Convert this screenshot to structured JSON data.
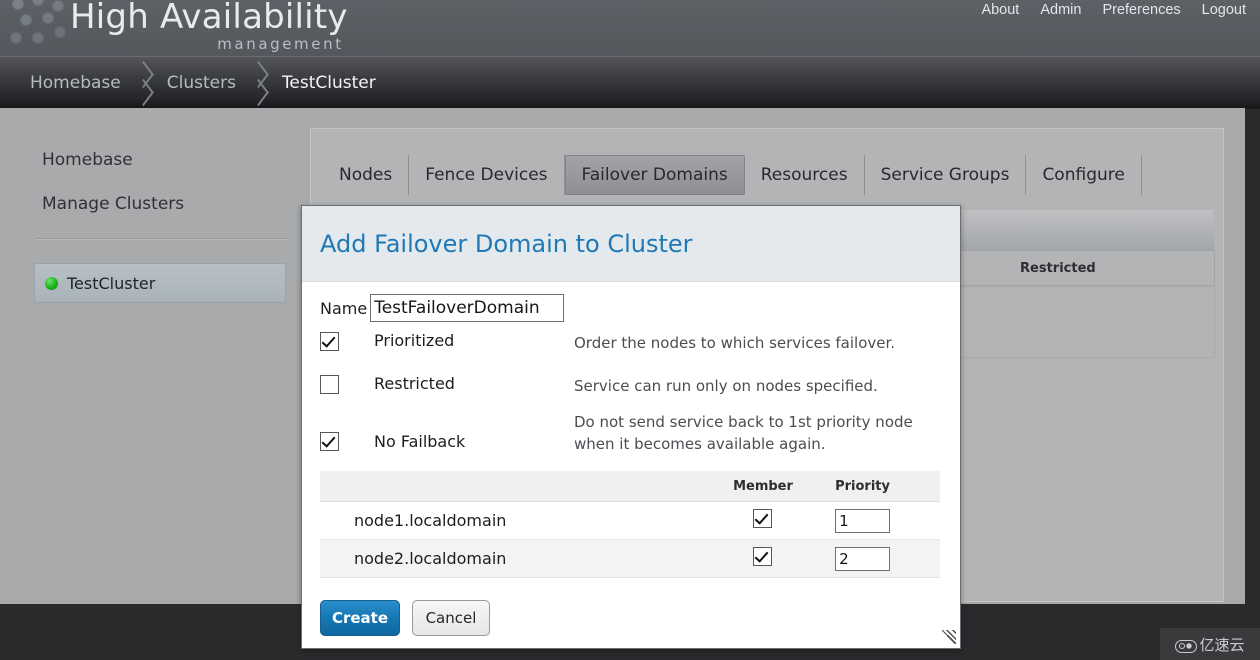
{
  "brand": {
    "title": "High Availability",
    "subtitle": "management",
    "logo_icon": "hex-dots-logo-icon"
  },
  "topnav": {
    "items": [
      {
        "label": "About"
      },
      {
        "label": "Admin"
      },
      {
        "label": "Preferences"
      },
      {
        "label": "Logout"
      }
    ]
  },
  "breadcrumb": {
    "items": [
      {
        "label": "Homebase",
        "active": false
      },
      {
        "label": "Clusters",
        "active": false
      },
      {
        "label": "TestCluster",
        "active": true
      }
    ]
  },
  "sidebar": {
    "links": [
      {
        "label": "Homebase"
      },
      {
        "label": "Manage Clusters"
      }
    ],
    "cluster": {
      "label": "TestCluster",
      "status_icon": "green-status-dot",
      "status_color": "#19b419"
    }
  },
  "content": {
    "tabs": [
      {
        "label": "Nodes",
        "selected": false
      },
      {
        "label": "Fence Devices",
        "selected": false
      },
      {
        "label": "Failover Domains",
        "selected": true
      },
      {
        "label": "Resources",
        "selected": false
      },
      {
        "label": "Service Groups",
        "selected": false
      },
      {
        "label": "Configure",
        "selected": false
      }
    ],
    "background_table": {
      "columns": [
        "Restricted"
      ]
    }
  },
  "dialog": {
    "title": "Add Failover Domain to Cluster",
    "title_color": "#2079b5",
    "name_label": "Name",
    "name_value": "TestFailoverDomain",
    "name_placeholder": "",
    "options": [
      {
        "label": "Prioritized",
        "checked": true,
        "description": "Order the nodes to which services failover."
      },
      {
        "label": "Restricted",
        "checked": false,
        "description": "Service can run only on nodes specified."
      },
      {
        "label": "No Failback",
        "checked": true,
        "description": "Do not send service back to 1st priority node when it becomes available again."
      }
    ],
    "member_table": {
      "columns": [
        "",
        "Member",
        "Priority"
      ],
      "rows": [
        {
          "node": "node1.localdomain",
          "member": true,
          "priority": "1"
        },
        {
          "node": "node2.localdomain",
          "member": true,
          "priority": "2"
        }
      ]
    },
    "buttons": {
      "create": "Create",
      "cancel": "Cancel"
    },
    "resize_icon": "resize-grip-icon"
  },
  "watermark": {
    "text": "亿速云",
    "icon": "cloud-icon"
  }
}
